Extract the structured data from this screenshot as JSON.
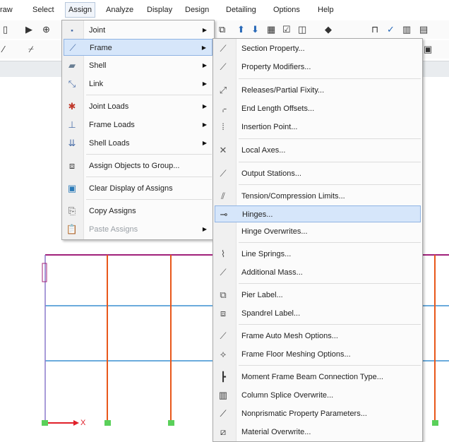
{
  "menubar": {
    "items": [
      "raw",
      "Select",
      "Assign",
      "Analyze",
      "Display",
      "Design",
      "Detailing",
      "Options",
      "Help"
    ]
  },
  "assign_menu": {
    "items": [
      {
        "label": "Joint",
        "icon": "joint-icon",
        "submenu": true
      },
      {
        "label": "Frame",
        "icon": "frame-icon",
        "submenu": true,
        "highlighted": true
      },
      {
        "label": "Shell",
        "icon": "shell-icon",
        "submenu": true
      },
      {
        "label": "Link",
        "icon": "link-icon",
        "submenu": true
      },
      {
        "label": "Joint Loads",
        "icon": "joint-loads-icon",
        "submenu": true
      },
      {
        "label": "Frame Loads",
        "icon": "frame-loads-icon",
        "submenu": true
      },
      {
        "label": "Shell Loads",
        "icon": "shell-loads-icon",
        "submenu": true
      },
      {
        "label": "Assign Objects to Group...",
        "icon": "group-icon",
        "submenu": false
      },
      {
        "label": "Clear Display of Assigns",
        "icon": "clear-display-icon",
        "submenu": false
      },
      {
        "label": "Copy Assigns",
        "icon": "copy-icon",
        "submenu": false
      },
      {
        "label": "Paste Assigns",
        "icon": "paste-icon",
        "submenu": true,
        "disabled": true
      }
    ]
  },
  "frame_menu": {
    "items": [
      {
        "label": "Section Property...",
        "icon": "section-property-icon"
      },
      {
        "label": "Property Modifiers...",
        "icon": "property-modifiers-icon"
      },
      {
        "label": "Releases/Partial Fixity...",
        "icon": "releases-icon"
      },
      {
        "label": "End Length Offsets...",
        "icon": "end-offsets-icon"
      },
      {
        "label": "Insertion Point...",
        "icon": "insertion-point-icon"
      },
      {
        "label": "Local Axes...",
        "icon": "local-axes-icon"
      },
      {
        "label": "Output Stations...",
        "icon": "output-stations-icon"
      },
      {
        "label": "Tension/Compression Limits...",
        "icon": "tension-compression-icon"
      },
      {
        "label": "Hinges...",
        "icon": "hinges-icon",
        "highlighted": true
      },
      {
        "label": "Hinge Overwrites...",
        "icon": ""
      },
      {
        "label": "Line Springs...",
        "icon": "line-springs-icon"
      },
      {
        "label": "Additional Mass...",
        "icon": "additional-mass-icon"
      },
      {
        "label": "Pier Label...",
        "icon": "pier-label-icon"
      },
      {
        "label": "Spandrel Label...",
        "icon": "spandrel-label-icon"
      },
      {
        "label": "Frame Auto Mesh Options...",
        "icon": "auto-mesh-icon"
      },
      {
        "label": "Frame Floor Meshing Options...",
        "icon": "floor-meshing-icon"
      },
      {
        "label": "Moment Frame Beam Connection Type...",
        "icon": "beam-connection-icon"
      },
      {
        "label": "Column Splice Overwrite...",
        "icon": "column-splice-icon"
      },
      {
        "label": "Nonprismatic Property Parameters...",
        "icon": "nonprismatic-icon"
      },
      {
        "label": "Material Overwrite...",
        "icon": "material-overwrite-icon"
      }
    ]
  },
  "canvas": {
    "axis_label": "X"
  },
  "colors": {
    "highlight": "#d6e6fa",
    "highlight_border": "#8fb3e3",
    "beam": "#a0207a",
    "column": "#e8571a",
    "grid_blue": "#3a8fd0",
    "support": "#5ad05a",
    "axis": "#e0202a"
  }
}
